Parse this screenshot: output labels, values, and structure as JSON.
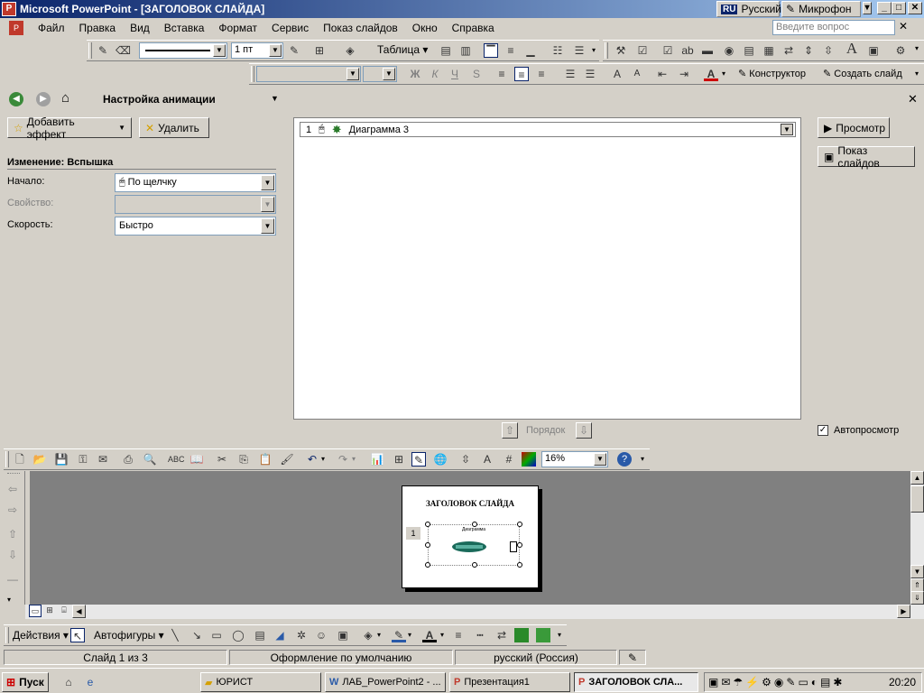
{
  "window": {
    "title": "Microsoft PowerPoint - [ЗАГОЛОВОК СЛАЙДА]",
    "language": "Русский",
    "language_code": "RU",
    "microphone": "Микрофон"
  },
  "menu": {
    "items": [
      "Файл",
      "Правка",
      "Вид",
      "Вставка",
      "Формат",
      "Сервис",
      "Показ слайдов",
      "Окно",
      "Справка"
    ],
    "ask_placeholder": "Введите вопрос"
  },
  "toolbar1": {
    "line_weight": "1 пт",
    "table_label": "Таблица"
  },
  "toolbar2": {
    "bold": "Ж",
    "italic": "К",
    "underline": "Ч",
    "shadow": "S",
    "designer": "Конструктор",
    "new_slide": "Создать слайд"
  },
  "taskpane": {
    "title": "Настройка анимации",
    "add_effect": "Добавить эффект",
    "remove": "Удалить",
    "change_heading": "Изменение: Вспышка",
    "start_label": "Начало:",
    "start_value": "По щелчку",
    "property_label": "Свойство:",
    "property_value": "",
    "speed_label": "Скорость:",
    "speed_value": "Быстро",
    "list_item_num": "1",
    "list_item_label": "Диаграмма 3",
    "order_label": "Порядок",
    "preview": "Просмотр",
    "slideshow": "Показ слайдов",
    "autopreview": "Автопросмотр",
    "autopreview_checked": true
  },
  "standard_toolbar": {
    "zoom": "16%"
  },
  "slide": {
    "title": "ЗАГОЛОВОК СЛАЙДА",
    "chart_caption": "Диаграмма",
    "number_tag": "1"
  },
  "drawing_toolbar": {
    "actions": "Действия",
    "autoshapes": "Автофигуры"
  },
  "status": {
    "slide": "Слайд 1 из 3",
    "design": "Оформление по умолчанию",
    "language": "русский (Россия)"
  },
  "taskbar": {
    "start": "Пуск",
    "items": [
      "ЮРИСТ",
      "ЛАБ_PowerPoint2 - ...",
      "Презентация1",
      "ЗАГОЛОВОК СЛА..."
    ],
    "clock": "20:20"
  }
}
